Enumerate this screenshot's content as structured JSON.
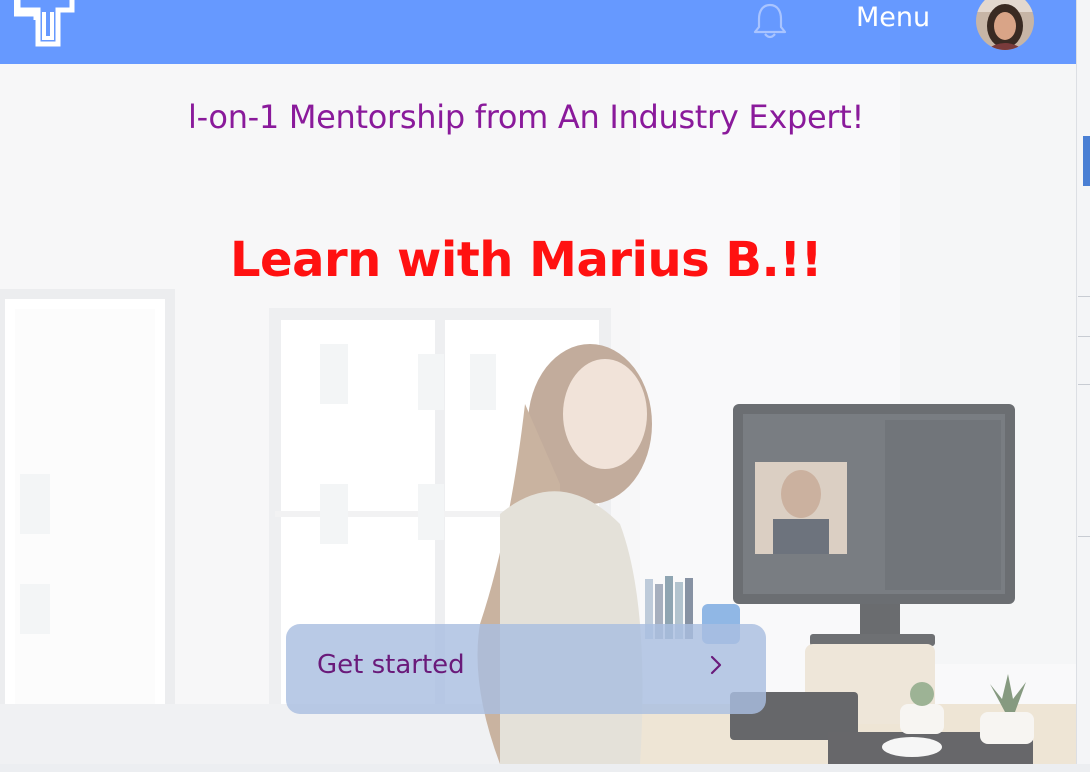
{
  "header": {
    "logo": "logo-icon",
    "notification_icon": "bell-icon",
    "menu_label": "Menu",
    "avatar": "user-avatar"
  },
  "hero": {
    "tagline": "l-on-1 Mentorship from An Industry Expert!",
    "headline": "Learn with Marius B.!!",
    "cta_label": "Get started",
    "cta_icon": "chevron-right-icon"
  },
  "colors": {
    "header_bg": "#6699ff",
    "tagline": "#8a1a9b",
    "headline": "#ff1111",
    "cta_bg": "#aabee1",
    "cta_text": "#6a1a7a"
  }
}
